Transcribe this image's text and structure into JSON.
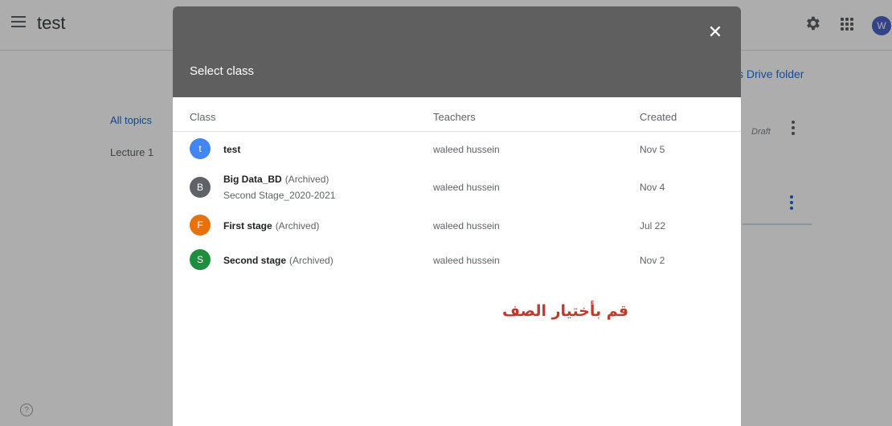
{
  "app": {
    "title": "test",
    "avatar_letter": "W"
  },
  "page": {
    "drive_link": "s Drive folder",
    "all_topics": "All topics",
    "lecture": "Lecture 1",
    "draft": "Draft",
    "help": "?"
  },
  "dialog": {
    "title": "Select class",
    "close": "✕",
    "columns": {
      "class": "Class",
      "teachers": "Teachers",
      "created": "Created"
    },
    "rows": [
      {
        "letter": "t",
        "color": "#4285f4",
        "name": "test",
        "archived": "",
        "section": "",
        "teacher": "waleed hussein",
        "created": "Nov 5"
      },
      {
        "letter": "B",
        "color": "#5f6368",
        "name": "Big Data_BD",
        "archived": "(Archived)",
        "section": "Second Stage_2020-2021",
        "teacher": "waleed hussein",
        "created": "Nov 4"
      },
      {
        "letter": "F",
        "color": "#e8710a",
        "name": "First stage",
        "archived": "(Archived)",
        "section": "",
        "teacher": "waleed hussein",
        "created": "Jul 22"
      },
      {
        "letter": "S",
        "color": "#1e8e3e",
        "name": "Second stage",
        "archived": "(Archived)",
        "section": "",
        "teacher": "waleed hussein",
        "created": "Nov 2"
      }
    ],
    "instruction": "قم بأختيار الصف"
  }
}
